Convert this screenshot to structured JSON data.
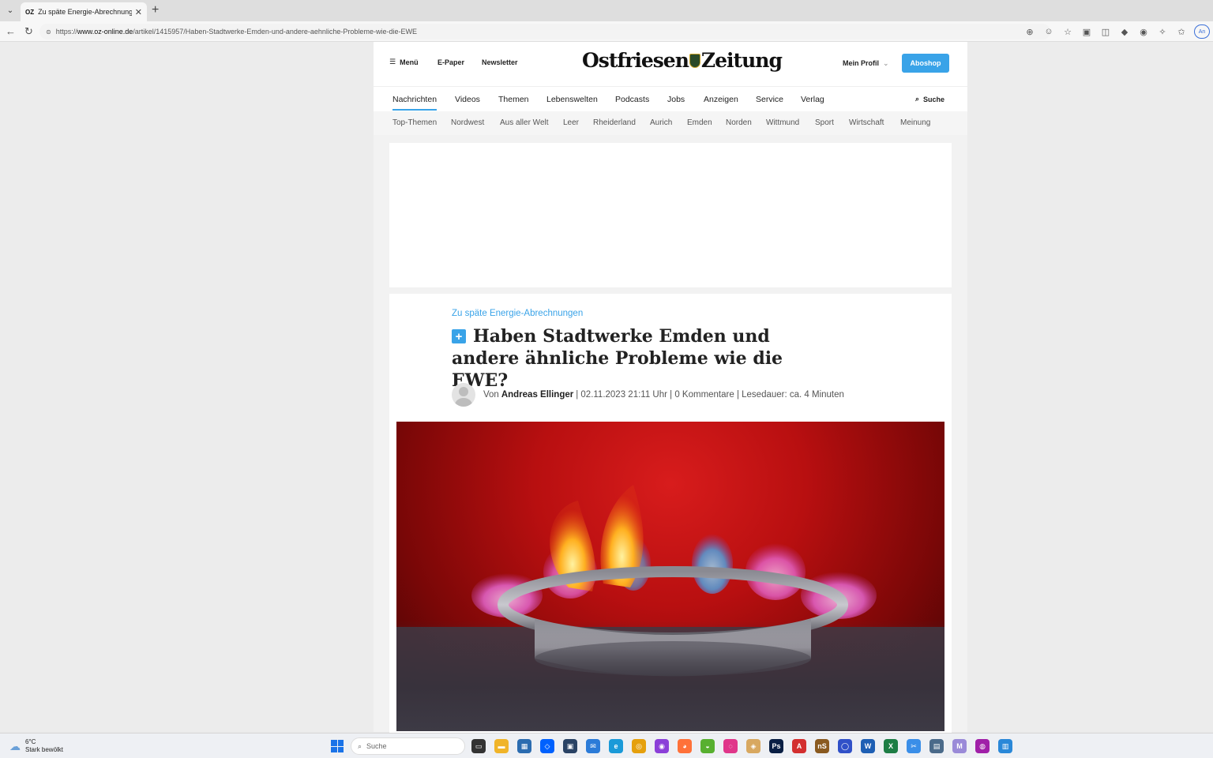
{
  "browser": {
    "tab_title": "Zu späte Energie-Abrechnungen: …",
    "tab_favicon_text": "OZ",
    "url_prefix": "https://",
    "url_host": "www.oz-online.de",
    "url_path": "/artikel/1415957/Haben-Stadtwerke-Emden-und-andere-aehnliche-Probleme-wie-die-EWE",
    "profile_initials": "An"
  },
  "header": {
    "menu_label": "Menü",
    "epaper_label": "E-Paper",
    "newsletter_label": "Newsletter",
    "logo_left": "Ostfriesen",
    "logo_right": "Zeitung",
    "profile_label": "Mein Profil",
    "aboshop_label": "Aboshop"
  },
  "main_nav": {
    "items": [
      "Nachrichten",
      "Videos",
      "Themen",
      "Lebenswelten",
      "Podcasts",
      "Jobs",
      "Anzeigen",
      "Service",
      "Verlag"
    ],
    "active": "Nachrichten",
    "search_label": "Suche"
  },
  "sub_nav": {
    "items": [
      "Top-Themen",
      "Nordwest",
      "Aus aller Welt",
      "Leer",
      "Rheiderland",
      "Aurich",
      "Emden",
      "Norden",
      "Wittmund",
      "Sport",
      "Wirtschaft",
      "Meinung"
    ]
  },
  "article": {
    "kicker": "Zu späte Energie-Abrechnungen",
    "plus_badge": "+",
    "headline": "Haben Stadtwerke Emden und andere ähnliche Probleme wie die EWE?",
    "byline_prefix": "Von",
    "author": "Andreas Ellinger",
    "meta": "| 02.11.2023 21:11 Uhr | 0 Kommentare | Lesedauer: ca. 4 Minuten"
  },
  "taskbar": {
    "temperature": "6°C",
    "weather_text": "Stark bewölkt",
    "search_label": "Suche"
  },
  "colors": {
    "accent": "#39a3e8",
    "hero_red": "#c8141a"
  }
}
